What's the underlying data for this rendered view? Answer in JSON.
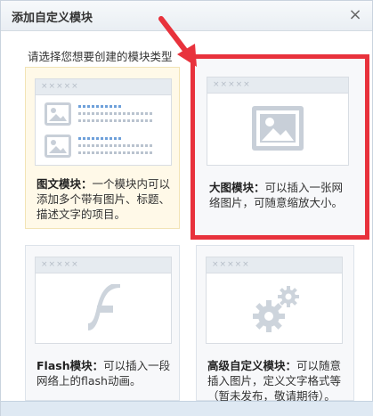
{
  "dialog": {
    "title": "添加自定义模块",
    "close_glyph": "×",
    "instruction": "请选择您想要创建的模块类型"
  },
  "cards": [
    {
      "name": "图文模块：",
      "text": "一个模块内可以添加多个带有图片、标题、描述文字的项目。",
      "icon": "image-text-icon",
      "highlighted": true
    },
    {
      "name": "大图模块：",
      "text": "可以插入一张网络图片，可随意缩放大小。",
      "icon": "image-icon",
      "selected_box": true
    },
    {
      "name": "Flash模块：",
      "text": "可以插入一段网络上的flash动画。",
      "icon": "flash-icon"
    },
    {
      "name": "高级自定义模块：",
      "text": "可以随意插入图片，定义文字格式等（暂未发布，敬请期待）。",
      "icon": "gears-icon"
    }
  ],
  "preview_bar": "×××××",
  "colors": {
    "highlight_border": "#e8323c",
    "highlight_bg": "#fff9e8"
  }
}
